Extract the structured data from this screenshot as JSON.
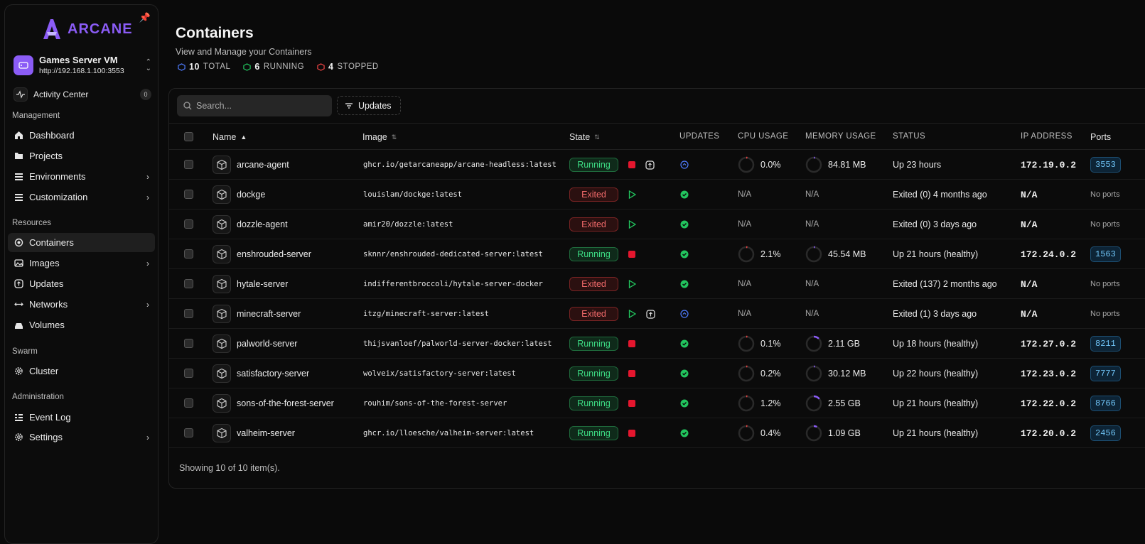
{
  "brand": {
    "name": "ARCANE"
  },
  "environment": {
    "name": "Games Server VM",
    "url": "http://192.168.1.100:3553"
  },
  "activity": {
    "label": "Activity Center",
    "count": "0"
  },
  "sidebar": {
    "sections": {
      "management": "Management",
      "resources": "Resources",
      "swarm": "Swarm",
      "administration": "Administration"
    },
    "items": {
      "dashboard": "Dashboard",
      "projects": "Projects",
      "environments": "Environments",
      "customization": "Customization",
      "containers": "Containers",
      "images": "Images",
      "updates": "Updates",
      "networks": "Networks",
      "volumes": "Volumes",
      "cluster": "Cluster",
      "event_log": "Event Log",
      "settings": "Settings"
    }
  },
  "header": {
    "title": "Containers",
    "subtitle": "View and Manage your Containers",
    "stats": {
      "total_count": "10",
      "total_label": "TOTAL",
      "running_count": "6",
      "running_label": "RUNNING",
      "stopped_count": "4",
      "stopped_label": "STOPPED"
    }
  },
  "toolbar": {
    "search_placeholder": "Search...",
    "updates_label": "Updates"
  },
  "table": {
    "columns": {
      "name": "Name",
      "image": "Image",
      "state": "State",
      "updates": "UPDATES",
      "cpu": "CPU USAGE",
      "memory": "MEMORY USAGE",
      "status": "STATUS",
      "ip": "IP ADDRESS",
      "ports": "Ports"
    },
    "rows": [
      {
        "name": "arcane-agent",
        "image": "ghcr.io/getarcaneapp/arcane-headless:latest",
        "state": "Running",
        "update": "info",
        "cpu": "0.0%",
        "cpu_level": 0.0,
        "memory": "84.81 MB",
        "mem_level": 0.02,
        "status": "Up 23 hours",
        "ip": "172.19.0.2",
        "port": "3553",
        "has_update_action": true
      },
      {
        "name": "dockge",
        "image": "louislam/dockge:latest",
        "state": "Exited",
        "update": "ok",
        "cpu": "N/A",
        "memory": "N/A",
        "status": "Exited (0) 4 months ago",
        "ip": "N/A",
        "port": "No ports",
        "has_update_action": false
      },
      {
        "name": "dozzle-agent",
        "image": "amir20/dozzle:latest",
        "state": "Exited",
        "update": "ok",
        "cpu": "N/A",
        "memory": "N/A",
        "status": "Exited (0) 3 days ago",
        "ip": "N/A",
        "port": "No ports",
        "has_update_action": false
      },
      {
        "name": "enshrouded-server",
        "image": "sknnr/enshrouded-dedicated-server:latest",
        "state": "Running",
        "update": "ok",
        "cpu": "2.1%",
        "cpu_level": 0.021,
        "memory": "45.54 MB",
        "mem_level": 0.02,
        "status": "Up 21 hours (healthy)",
        "ip": "172.24.0.2",
        "port": "1563",
        "has_update_action": false
      },
      {
        "name": "hytale-server",
        "image": "indifferentbroccoli/hytale-server-docker",
        "state": "Exited",
        "update": "ok",
        "cpu": "N/A",
        "memory": "N/A",
        "status": "Exited (137) 2 months ago",
        "ip": "N/A",
        "port": "No ports",
        "has_update_action": false
      },
      {
        "name": "minecraft-server",
        "image": "itzg/minecraft-server:latest",
        "state": "Exited",
        "update": "info",
        "cpu": "N/A",
        "memory": "N/A",
        "status": "Exited (1) 3 days ago",
        "ip": "N/A",
        "port": "No ports",
        "has_update_action": true
      },
      {
        "name": "palworld-server",
        "image": "thijsvanloef/palworld-server-docker:latest",
        "state": "Running",
        "update": "ok",
        "cpu": "0.1%",
        "cpu_level": 0.001,
        "memory": "2.11 GB",
        "mem_level": 0.12,
        "status": "Up 18 hours (healthy)",
        "ip": "172.27.0.2",
        "port": "8211",
        "has_update_action": false
      },
      {
        "name": "satisfactory-server",
        "image": "wolveix/satisfactory-server:latest",
        "state": "Running",
        "update": "ok",
        "cpu": "0.2%",
        "cpu_level": 0.002,
        "memory": "30.12 MB",
        "mem_level": 0.02,
        "status": "Up 22 hours (healthy)",
        "ip": "172.23.0.2",
        "port": "7777",
        "has_update_action": false
      },
      {
        "name": "sons-of-the-forest-server",
        "image": "rouhim/sons-of-the-forest-server",
        "state": "Running",
        "update": "ok",
        "cpu": "1.2%",
        "cpu_level": 0.012,
        "memory": "2.55 GB",
        "mem_level": 0.14,
        "status": "Up 21 hours (healthy)",
        "ip": "172.22.0.2",
        "port": "8766",
        "has_update_action": false
      },
      {
        "name": "valheim-server",
        "image": "ghcr.io/lloesche/valheim-server:latest",
        "state": "Running",
        "update": "ok",
        "cpu": "0.4%",
        "cpu_level": 0.004,
        "memory": "1.09 GB",
        "mem_level": 0.07,
        "status": "Up 21 hours (healthy)",
        "ip": "172.20.0.2",
        "port": "2456",
        "has_update_action": false
      }
    ]
  },
  "footer": {
    "text": "Showing 10 of 10 item(s)."
  },
  "colors": {
    "accent": "#8b5cf6",
    "running": "#3ddc84",
    "exited": "#f36b6b",
    "stop": "#e5162e",
    "info": "#4f7cff"
  }
}
